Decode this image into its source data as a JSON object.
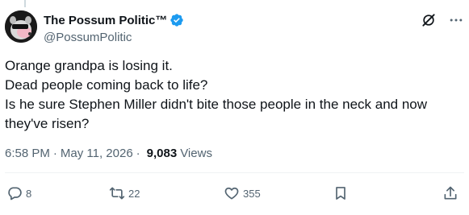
{
  "author": {
    "display_name": "The Possum Politic™",
    "handle": "@PossumPolitic"
  },
  "post": {
    "lines": [
      "Orange grandpa is losing it.",
      "Dead people coming back to life?",
      "Is he sure Stephen Miller didn't bite those people in the neck and now",
      "they've risen?"
    ]
  },
  "meta": {
    "time": "6:58 PM",
    "separator": "·",
    "date": "May 11, 2026",
    "views_count": "9,083",
    "views_label": "Views"
  },
  "actions": {
    "replies": "8",
    "reposts": "22",
    "likes": "355"
  },
  "icons": {
    "verified": "verified-badge-icon",
    "grok": "grok-icon",
    "more": "more-icon",
    "reply": "reply-icon",
    "repost": "repost-icon",
    "like": "heart-icon",
    "bookmark": "bookmark-icon",
    "share": "share-icon"
  },
  "colors": {
    "verified": "#1d9bf0",
    "text": "#0f1419",
    "secondary": "#536471"
  }
}
